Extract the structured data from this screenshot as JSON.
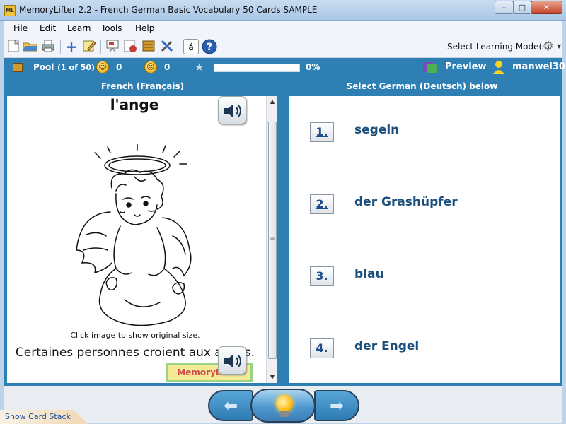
{
  "window": {
    "title": "MemoryLifter 2.2 - French German Basic Vocabulary 50 Cards SAMPLE",
    "app_icon_text": "ML",
    "minimize": "–",
    "maximize": "□",
    "close": "✕"
  },
  "menu": [
    "File",
    "Edit",
    "Learn",
    "Tools",
    "Help"
  ],
  "toolbar": {
    "icons": [
      "new-document-icon",
      "open-folder-icon",
      "print-icon",
      "add-card-icon",
      "edit-card-icon",
      "presentation-icon",
      "statistics-icon",
      "card-stack-icon",
      "tools-icon",
      "character-map-icon",
      "help-icon"
    ],
    "select_mode_label": "Select Learning Mode(s)"
  },
  "status": {
    "pool_label": "Pool",
    "pool_count": "(1 of 50)",
    "correct_count": "0",
    "wrong_count": "0",
    "progress_percent_label": "0%",
    "progress_value": 0,
    "preview_label": "Preview",
    "username": "manwei30"
  },
  "headers": {
    "left": "French (Français)",
    "right": "Select German (Deutsch) below"
  },
  "question": {
    "word": "l'ange",
    "image_hint": "Click image to show original size.",
    "sentence": "Certaines personnes croient aux anges.",
    "badge": "MemoryLifter"
  },
  "options": [
    {
      "number": "1.",
      "text": "segeln"
    },
    {
      "number": "2.",
      "text": "der Grashüpfer"
    },
    {
      "number": "3.",
      "text": "blau"
    },
    {
      "number": "4.",
      "text": "der Engel"
    }
  ],
  "bottom": {
    "show_card_stack": "Show Card Stack"
  },
  "colors": {
    "panel_blue": "#2d7fb4",
    "option_text": "#1d4f7c"
  }
}
